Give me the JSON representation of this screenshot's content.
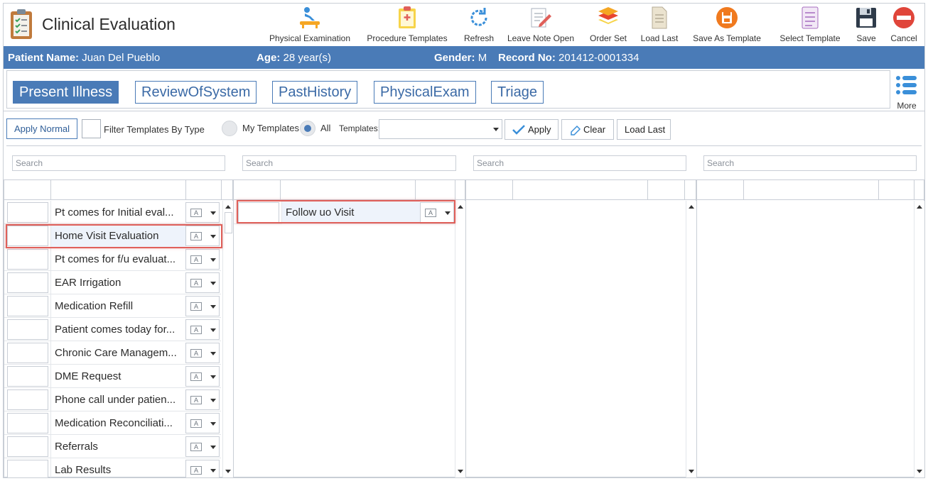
{
  "app": {
    "title": "Clinical Evaluation"
  },
  "toolbar": [
    {
      "label": "Physical Examination",
      "icon": "physical-exam-icon"
    },
    {
      "label": "Procedure Templates",
      "icon": "clipboard-icon"
    },
    {
      "label": "Refresh",
      "icon": "refresh-icon"
    },
    {
      "label": "Leave Note Open",
      "icon": "note-edit-icon"
    },
    {
      "label": "Order Set",
      "icon": "layers-icon"
    },
    {
      "label": "Load Last",
      "icon": "document-icon"
    },
    {
      "label": "Save As Template",
      "icon": "save-template-icon"
    },
    {
      "label": "Select Template",
      "icon": "list-document-icon"
    },
    {
      "label": "Save",
      "icon": "floppy-disk-icon"
    },
    {
      "label": "Cancel",
      "icon": "cancel-icon"
    }
  ],
  "patient": {
    "name_label": "Patient Name:",
    "name": "Juan Del Pueblo",
    "age_label": "Age:",
    "age": "28 year(s)",
    "gender_label": "Gender:",
    "gender": "M",
    "record_label": "Record No:",
    "record": "201412-0001334"
  },
  "tabs": [
    {
      "label": "Present Illness",
      "active": true
    },
    {
      "label": "ReviewOfSystem",
      "active": false
    },
    {
      "label": "PastHistory",
      "active": false
    },
    {
      "label": "PhysicalExam",
      "active": false
    },
    {
      "label": "Triage",
      "active": false
    }
  ],
  "more": {
    "label": "More"
  },
  "filters": {
    "apply_normal": "Apply Normal",
    "filter_by_type": "Filter Templates By Type",
    "my_templates": "My Templates",
    "all": "All",
    "templates_label": "Templates:",
    "templates_value": "",
    "apply": "Apply",
    "clear": "Clear",
    "load_last": "Load Last",
    "selected_radio": "All"
  },
  "search_placeholder": "Search",
  "columns": [
    {
      "rows": [
        "Pt comes for Initial eval...",
        "Home Visit Evaluation",
        "Pt comes for f/u evaluat...",
        "EAR Irrigation",
        "Medication Refill",
        "Patient comes today for...",
        "Chronic Care Managem...",
        "DME Request",
        "Phone call under patien...",
        "Medication Reconciliati...",
        "Referrals",
        "Lab Results"
      ],
      "selected": 1
    },
    {
      "rows": [
        "Follow uo Visit"
      ],
      "selected": 0
    },
    {
      "rows": [],
      "selected": -1
    },
    {
      "rows": [],
      "selected": -1
    }
  ],
  "colors": {
    "brand": "#4a7bb7",
    "highlight": "#e0605a"
  }
}
